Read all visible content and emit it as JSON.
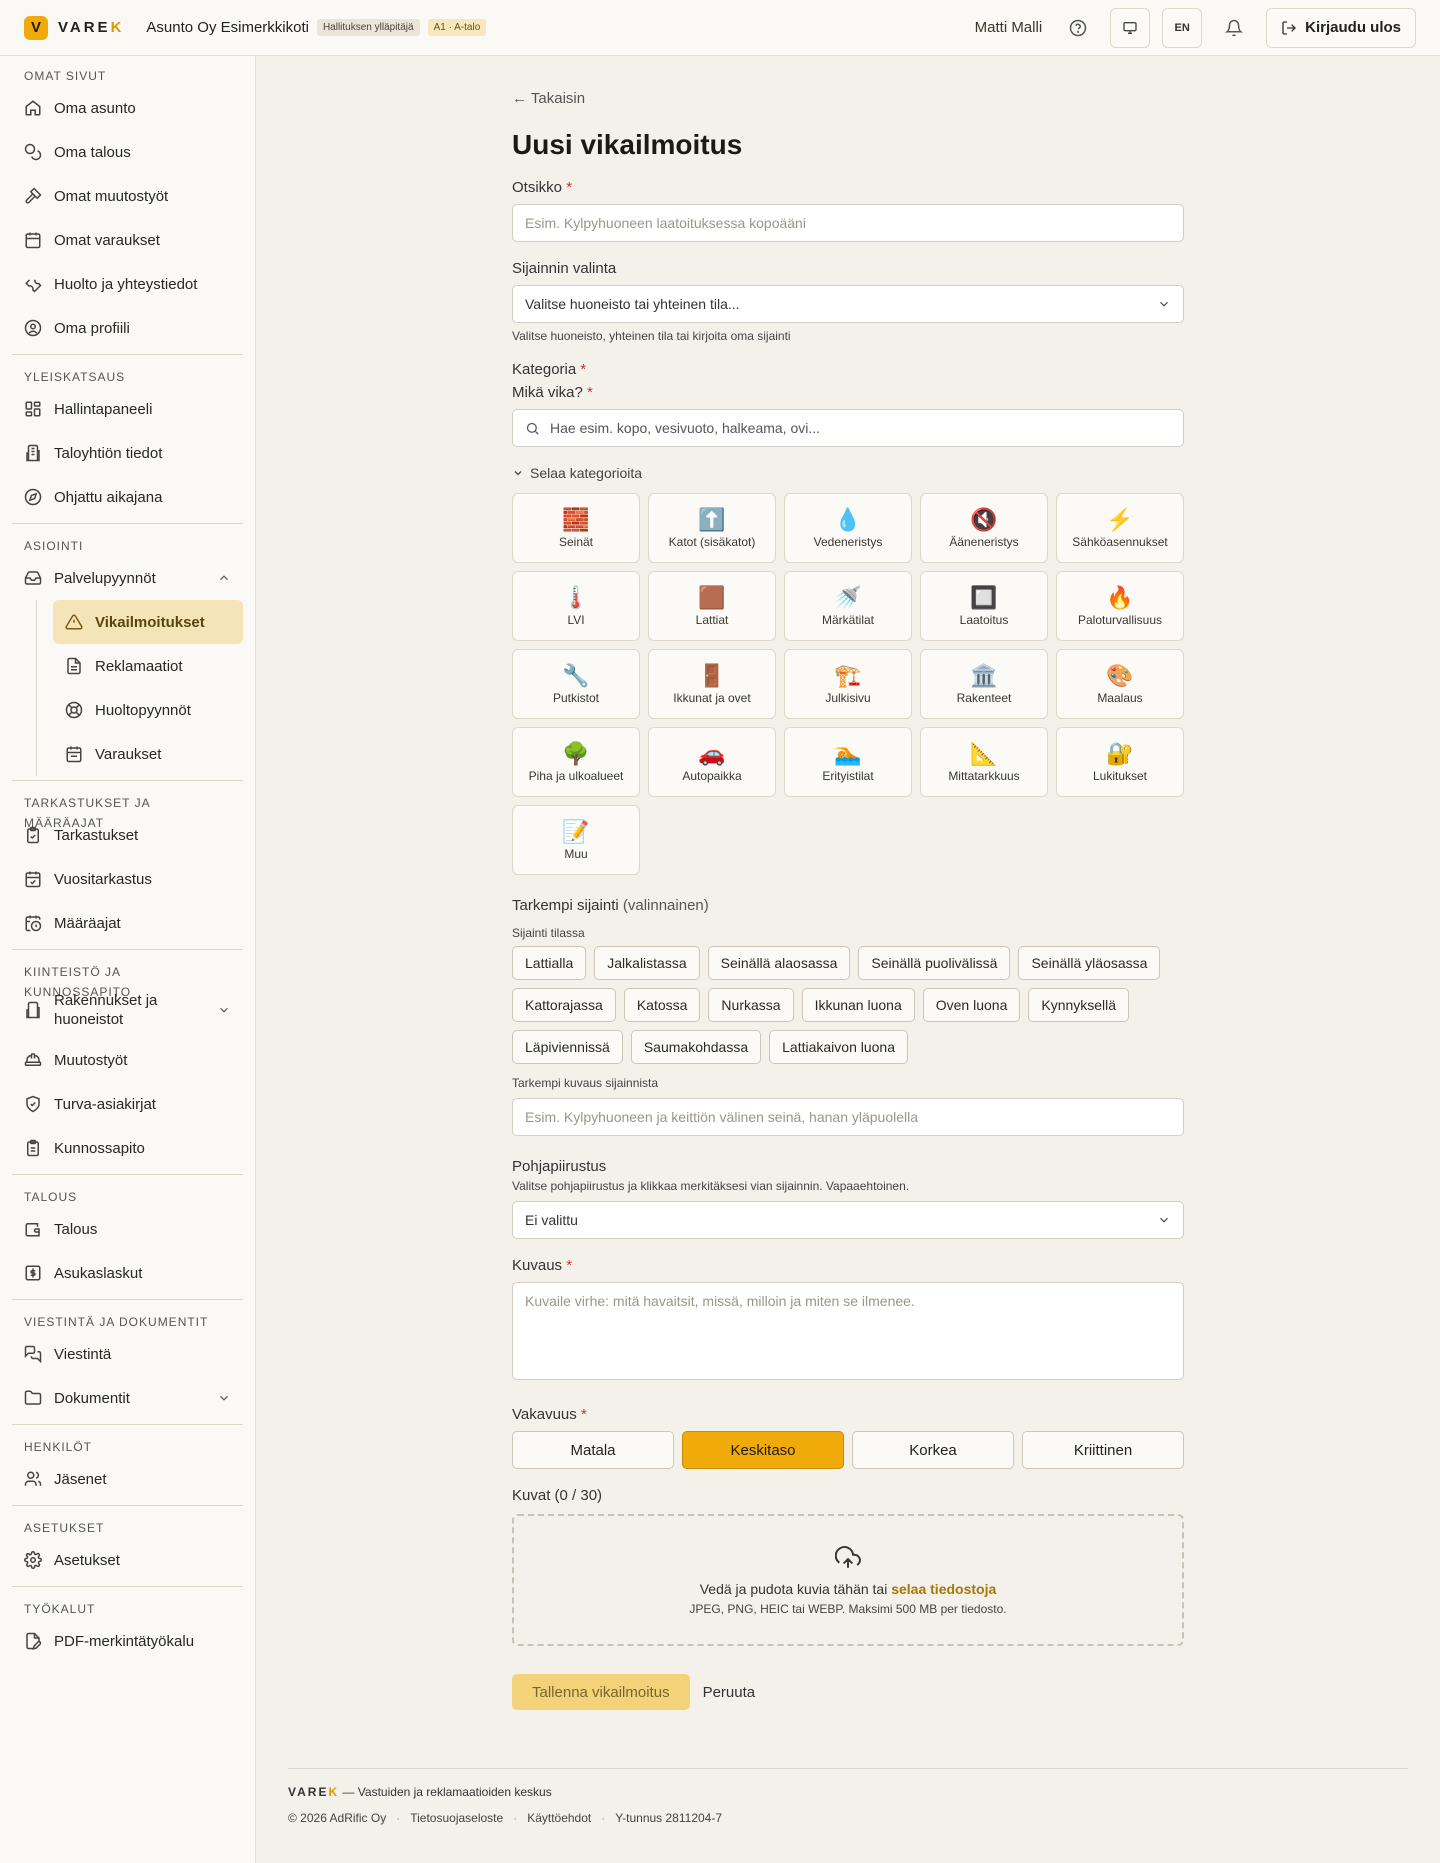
{
  "topbar": {
    "logo_letter": "V",
    "logo_text_main": "VARE",
    "logo_text_accent": "K",
    "org_name": "Asunto Oy Esimerkkikoti",
    "role_badge": "Hallituksen ylläpitäjä",
    "unit_badge": "A1 · A-talo",
    "user_name": "Matti Malli",
    "lang": "EN",
    "logout_label": "Kirjaudu ulos"
  },
  "sidebar": {
    "own": {
      "title": "OMAT SIVUT",
      "items": [
        "Oma asunto",
        "Oma talous",
        "Omat muutostyöt",
        "Omat varaukset",
        "Huolto ja yhteystiedot",
        "Oma profiili"
      ]
    },
    "overview": {
      "title": "YLEISKATSAUS",
      "items": [
        "Hallintapaneeli",
        "Taloyhtiön tiedot",
        "Ohjattu aikajana"
      ]
    },
    "matters": {
      "title": "ASIOINTI",
      "parent": "Palvelupyynnöt",
      "items": [
        "Vikailmoitukset",
        "Reklamaatiot",
        "Huoltopyynnöt",
        "Varaukset"
      ]
    },
    "inspections": {
      "title": "TARKASTUKSET JA MÄÄRÄAJAT",
      "items": [
        "Tarkastukset",
        "Vuositarkastus",
        "Määräajat"
      ]
    },
    "property": {
      "title": "KIINTEISTÖ JA KUNNOSSAPITO",
      "items": [
        "Rakennukset ja huoneistot",
        "Muutostyöt",
        "Turva-asiakirjat",
        "Kunnossapito"
      ]
    },
    "finance": {
      "title": "TALOUS",
      "items": [
        "Talous",
        "Asukaslaskut"
      ]
    },
    "comms": {
      "title": "VIESTINTÄ JA DOKUMENTIT",
      "items": [
        "Viestintä",
        "Dokumentit"
      ]
    },
    "people": {
      "title": "HENKILÖT",
      "items": [
        "Jäsenet"
      ]
    },
    "settings": {
      "title": "ASETUKSET",
      "items": [
        "Asetukset"
      ]
    },
    "tools": {
      "title": "TYÖKALUT",
      "items": [
        "PDF-merkintätyökalu"
      ]
    }
  },
  "form": {
    "back": "← Takaisin",
    "title": "Uusi vikailmoitus",
    "otsikko_label": "Otsikko",
    "otsikko_placeholder": "Esim. Kylpyhuoneen laatoituksessa kopoääni",
    "location_label": "Sijainnin valinta",
    "location_value": "Valitse huoneisto tai yhteinen tila...",
    "location_help": "Valitse huoneisto, yhteinen tila tai kirjoita oma sijainti",
    "category_label": "Kategoria",
    "fault_label": "Mikä vika?",
    "fault_placeholder": "Hae esim. kopo, vesivuoto, halkeama, ovi...",
    "browse_label": "Selaa kategorioita",
    "categories": [
      {
        "icon": "🧱",
        "label": "Seinät"
      },
      {
        "icon": "⬆️",
        "label": "Katot (sisäkatot)"
      },
      {
        "icon": "💧",
        "label": "Vedeneristys"
      },
      {
        "icon": "🔇",
        "label": "Ääneneristys"
      },
      {
        "icon": "⚡",
        "label": "Sähköasennukset"
      },
      {
        "icon": "🌡️",
        "label": "LVI"
      },
      {
        "icon": "🟫",
        "label": "Lattiat"
      },
      {
        "icon": "🚿",
        "label": "Märkätilat"
      },
      {
        "icon": "🔲",
        "label": "Laatoitus"
      },
      {
        "icon": "🔥",
        "label": "Paloturvallisuus"
      },
      {
        "icon": "🔧",
        "label": "Putkistot"
      },
      {
        "icon": "🚪",
        "label": "Ikkunat ja ovet"
      },
      {
        "icon": "🏗️",
        "label": "Julkisivu"
      },
      {
        "icon": "🏛️",
        "label": "Rakenteet"
      },
      {
        "icon": "🎨",
        "label": "Maalaus"
      },
      {
        "icon": "🌳",
        "label": "Piha ja ulkoalueet"
      },
      {
        "icon": "🚗",
        "label": "Autopaikka"
      },
      {
        "icon": "🏊",
        "label": "Erityistilat"
      },
      {
        "icon": "📐",
        "label": "Mittatarkkuus"
      },
      {
        "icon": "🔐",
        "label": "Lukitukset"
      },
      {
        "icon": "📝",
        "label": "Muu"
      }
    ],
    "detail_label": "Tarkempi sijainti",
    "detail_optional": "(valinnainen)",
    "space_label": "Sijainti tilassa",
    "space_chips": [
      "Lattialla",
      "Jalkalistassa",
      "Seinällä alaosassa",
      "Seinällä puolivälissä",
      "Seinällä yläosassa",
      "Kattorajassa",
      "Katossa",
      "Nurkassa",
      "Ikkunan luona",
      "Oven luona",
      "Kynnyksellä",
      "Läpiviennissä",
      "Saumakohdassa",
      "Lattiakaivon luona"
    ],
    "detail_desc_label": "Tarkempi kuvaus sijainnista",
    "detail_desc_placeholder": "Esim. Kylpyhuoneen ja keittiön välinen seinä, hanan yläpuolella",
    "plan_label": "Pohjapiirustus",
    "plan_help": "Valitse pohjapiirustus ja klikkaa merkitäksesi vian sijainnin. Vapaaehtoinen.",
    "plan_value": "Ei valittu",
    "desc_label": "Kuvaus",
    "desc_placeholder": "Kuvaile virhe: mitä havaitsit, missä, milloin ja miten se ilmenee.",
    "severity_label": "Vakavuus",
    "severity_options": [
      "Matala",
      "Keskitaso",
      "Korkea",
      "Kriittinen"
    ],
    "severity_selected": "Keskitaso",
    "images_label": "Kuvat (0 / 30)",
    "drop_text": "Vedä ja pudota kuvia tähän tai",
    "drop_link": "selaa tiedostoja",
    "drop_formats": "JPEG, PNG, HEIC tai WEBP. Maksimi 500 MB per tiedosto.",
    "save_label": "Tallenna vikailmoitus",
    "cancel_label": "Peruuta"
  },
  "footer": {
    "brand_main": "VARE",
    "brand_accent": "K",
    "tagline": "— Vastuiden ja reklamaatioiden keskus",
    "copyright": "© 2026 AdRific Oy",
    "privacy": "Tietosuojaseloste",
    "terms": "Käyttöehdot",
    "business_id": "Y-tunnus 2811204-7"
  },
  "colors": {
    "accent": "#f0ab0b",
    "background": "#f3f1ea",
    "sidebar": "#faf9f5",
    "active_nav": "#f6e4b9",
    "required": "#d0342c"
  }
}
